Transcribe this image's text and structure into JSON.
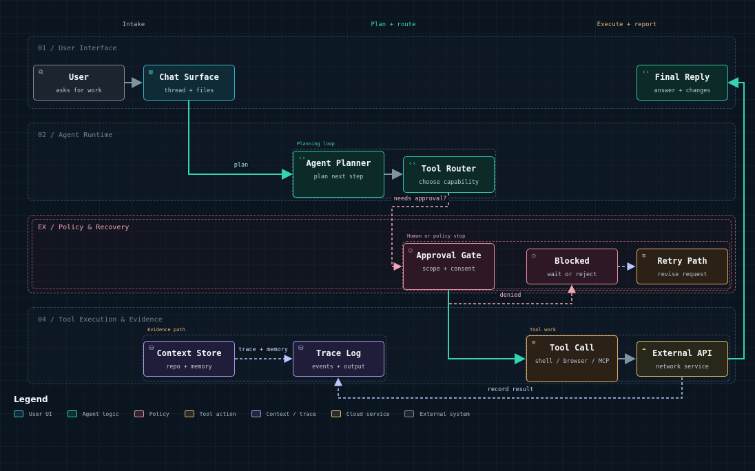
{
  "columns": [
    {
      "label": "Intake",
      "color": "#aab6c2"
    },
    {
      "label": "Plan + route",
      "color": "#3ed3b1"
    },
    {
      "label": "Execute + report",
      "color": "#e8b771"
    }
  ],
  "bands": {
    "ui": "01 / User Interface",
    "runtime": "02 / Agent Runtime",
    "policy": "EX / Policy & Recovery",
    "tools": "04 / Tool Execution & Evidence"
  },
  "groups": {
    "planning": "Planning loop",
    "human": "Human or policy stop",
    "evidence": "Evidence path",
    "toolwork": "Tool work"
  },
  "nodes": {
    "user": {
      "title": "User",
      "sub": "asks for work",
      "icon": "window-icon"
    },
    "chat": {
      "title": "Chat Surface",
      "sub": "thread + files",
      "icon": "browser-icon"
    },
    "reply": {
      "title": "Final Reply",
      "sub": "answer + changes",
      "icon": "code-icon"
    },
    "planner": {
      "title": "Agent Planner",
      "sub": "plan next step",
      "icon": "code-icon"
    },
    "router": {
      "title": "Tool Router",
      "sub": "choose capability",
      "icon": "code-icon"
    },
    "approval": {
      "title": "Approval Gate",
      "sub": "scope + consent",
      "icon": "shield-icon"
    },
    "blocked": {
      "title": "Blocked",
      "sub": "wait or reject",
      "icon": "shield-icon"
    },
    "retry": {
      "title": "Retry Path",
      "sub": "revise request",
      "icon": "list-icon"
    },
    "context": {
      "title": "Context Store",
      "sub": "repo + memory",
      "icon": "database-icon"
    },
    "trace": {
      "title": "Trace Log",
      "sub": "events + output",
      "icon": "database-icon"
    },
    "toolcall": {
      "title": "Tool Call",
      "sub": "shell / browser / MCP",
      "icon": "list-icon"
    },
    "api": {
      "title": "External API",
      "sub": "network service",
      "icon": "cloud-icon"
    }
  },
  "edge_labels": {
    "plan": "plan",
    "needs_approval": "needs approval?",
    "denied": "denied",
    "trace_memory": "trace + memory",
    "record_result": "record result"
  },
  "legend": {
    "title": "Legend",
    "items": [
      {
        "label": "User UI",
        "color": "#2fb7c9"
      },
      {
        "label": "Agent logic",
        "color": "#2ec8a6"
      },
      {
        "label": "Policy",
        "color": "#e990a4"
      },
      {
        "label": "Tool action",
        "color": "#e2ad66"
      },
      {
        "label": "Context / trace",
        "color": "#a79be6"
      },
      {
        "label": "Cloud service",
        "color": "#e0c46a"
      },
      {
        "label": "External system",
        "color": "#7f8c98"
      }
    ]
  }
}
